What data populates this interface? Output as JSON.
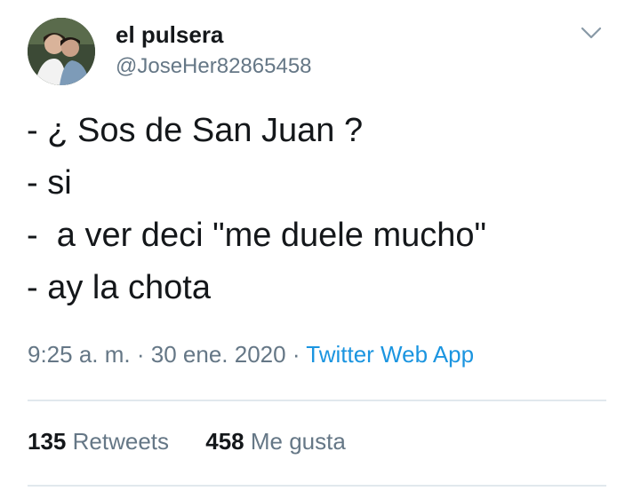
{
  "user": {
    "name": "el pulsera",
    "handle": "@JoseHer82865458"
  },
  "tweet": {
    "lines": [
      "- ¿ Sos de San Juan ?",
      "- si",
      "-  a ver deci \"me duele mucho\"",
      "- ay la chota"
    ],
    "time": "9:25 a. m.",
    "separator": "·",
    "date": "30 ene. 2020",
    "source": "Twitter Web App"
  },
  "stats": {
    "retweets_count": "135",
    "retweets_label": "Retweets",
    "likes_count": "458",
    "likes_label": "Me gusta"
  },
  "icons": {
    "menu": "chevron-down-icon"
  },
  "colors": {
    "text": "#14171a",
    "secondary": "#657786",
    "link": "#1b95e0",
    "divider": "#e1e8ed"
  }
}
